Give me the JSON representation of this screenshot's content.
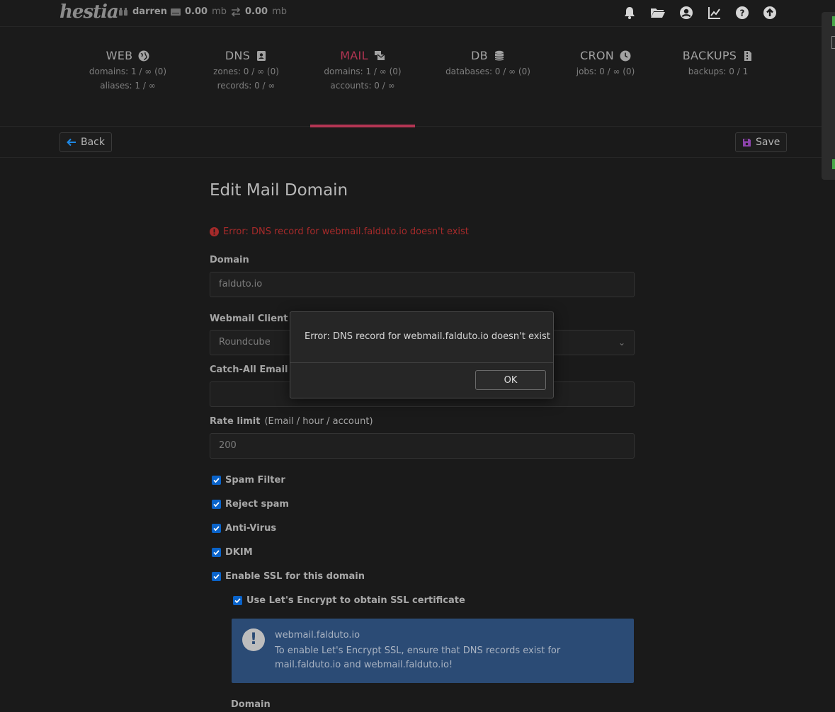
{
  "topbar": {
    "logo": "hestia",
    "user": "darren",
    "disk_value": "0.00",
    "disk_unit": "mb",
    "bandwidth_value": "0.00",
    "bandwidth_unit": "mb",
    "icons": [
      "bell-icon",
      "folder-open-icon",
      "user-circle-icon",
      "chart-line-icon",
      "question-circle-icon",
      "arrow-up-circle-icon"
    ]
  },
  "tabs": [
    {
      "name": "WEB",
      "icon": "globe-icon",
      "line1": "domains: 1 / ∞ (0)",
      "line2": "aliases: 1 / ∞"
    },
    {
      "name": "DNS",
      "icon": "address-book-icon",
      "line1": "zones: 0 / ∞ (0)",
      "line2": "records: 0 / ∞"
    },
    {
      "name": "MAIL",
      "icon": "mail-bulk-icon",
      "line1": "domains: 1 / ∞ (0)",
      "line2": "accounts: 0 / ∞",
      "active": true
    },
    {
      "name": "DB",
      "icon": "database-icon",
      "line1": "databases: 0 / ∞ (0)"
    },
    {
      "name": "CRON",
      "icon": "clock-icon",
      "line1": "jobs: 0 / ∞ (0)"
    },
    {
      "name": "BACKUPS",
      "icon": "file-archive-icon",
      "line1": "backups: 0 / 1"
    }
  ],
  "toolbar": {
    "back_label": "Back",
    "save_label": "Save"
  },
  "form": {
    "title": "Edit Mail Domain",
    "error": "Error: DNS record for webmail.falduto.io doesn't exist",
    "domain_label": "Domain",
    "domain_value": "falduto.io",
    "webmail_label": "Webmail Client",
    "webmail_value": "Roundcube",
    "catchall_label": "Catch-All Email",
    "catchall_value": "",
    "rate_label": "Rate limit",
    "rate_sub": "(Email / hour / account)",
    "rate_value": "200",
    "checkboxes": {
      "spam_filter": "Spam Filter",
      "reject_spam": "Reject spam",
      "antivirus": "Anti-Virus",
      "dkim": "DKIM",
      "ssl": "Enable SSL for this domain",
      "letsencrypt": "Use Let's Encrypt to obtain SSL certificate"
    },
    "info": {
      "heading": "webmail.falduto.io",
      "body": "To enable Let's Encrypt SSL, ensure that DNS records exist for mail.falduto.io and webmail.falduto.io!"
    },
    "bottom_label": "Domain"
  },
  "dialog": {
    "message": "Error: DNS record for webmail.falduto.io doesn't exist",
    "ok_label": "OK"
  },
  "colors": {
    "accent": "#b33553",
    "checkbox": "#0a63c9",
    "info_bg": "#2b4b75",
    "error": "#a52a2a"
  }
}
